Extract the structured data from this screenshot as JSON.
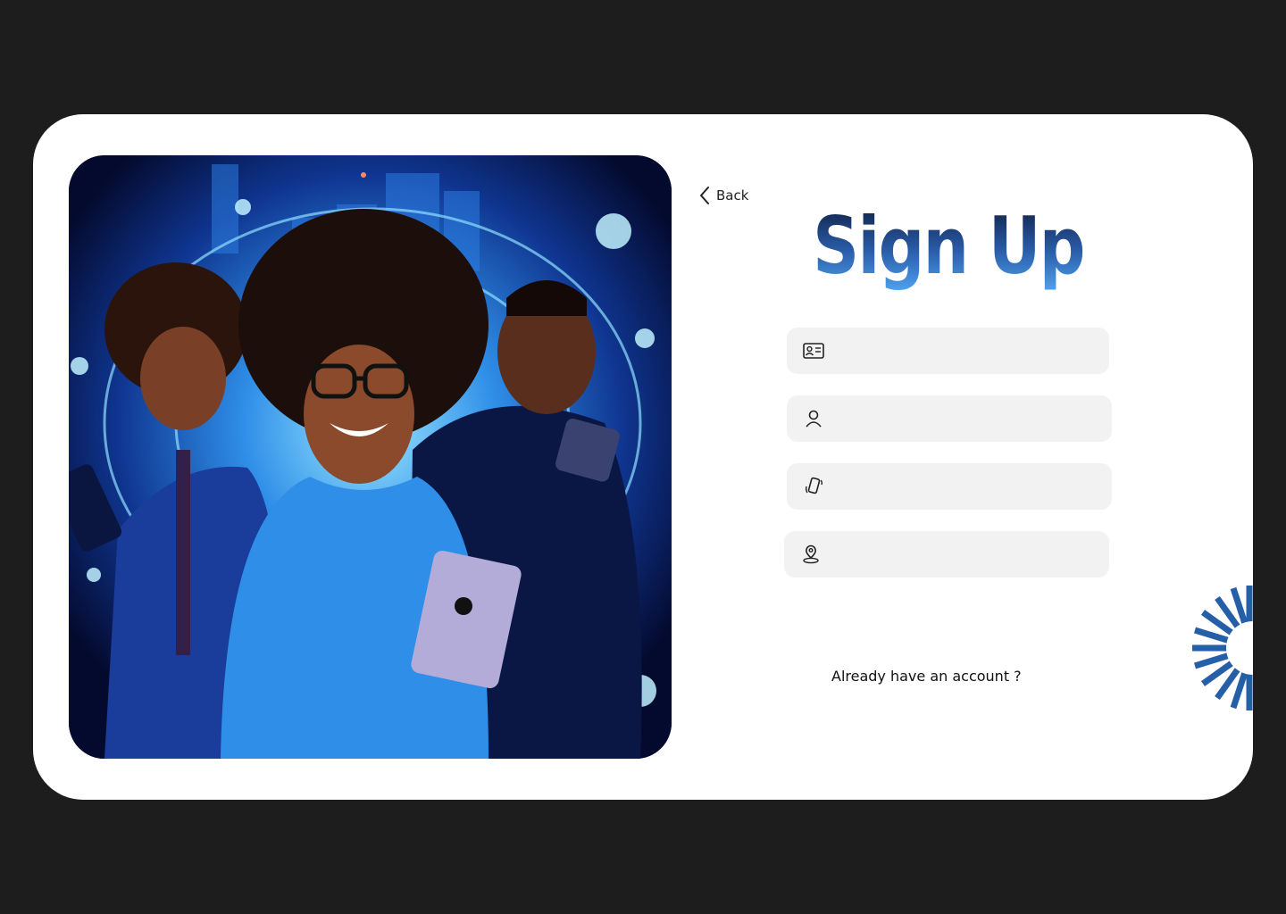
{
  "hero": {
    "image_alt": "Three people smiling holding phones and a tablet in front of a glowing blue tech background"
  },
  "nav": {
    "back_label": "Back"
  },
  "form": {
    "title": "Sign Up",
    "fields": [
      {
        "icon": "id-card-icon",
        "value": "",
        "placeholder": ""
      },
      {
        "icon": "user-icon",
        "value": "",
        "placeholder": ""
      },
      {
        "icon": "phone-icon",
        "value": "",
        "placeholder": ""
      },
      {
        "icon": "location-pin-icon",
        "value": "",
        "placeholder": ""
      }
    ],
    "login_prompt": "Already have an account ?"
  },
  "colors": {
    "background": "#1d1d1d",
    "card": "#ffffff",
    "field": "#f2f2f2",
    "accent": "#2a5ca8"
  }
}
